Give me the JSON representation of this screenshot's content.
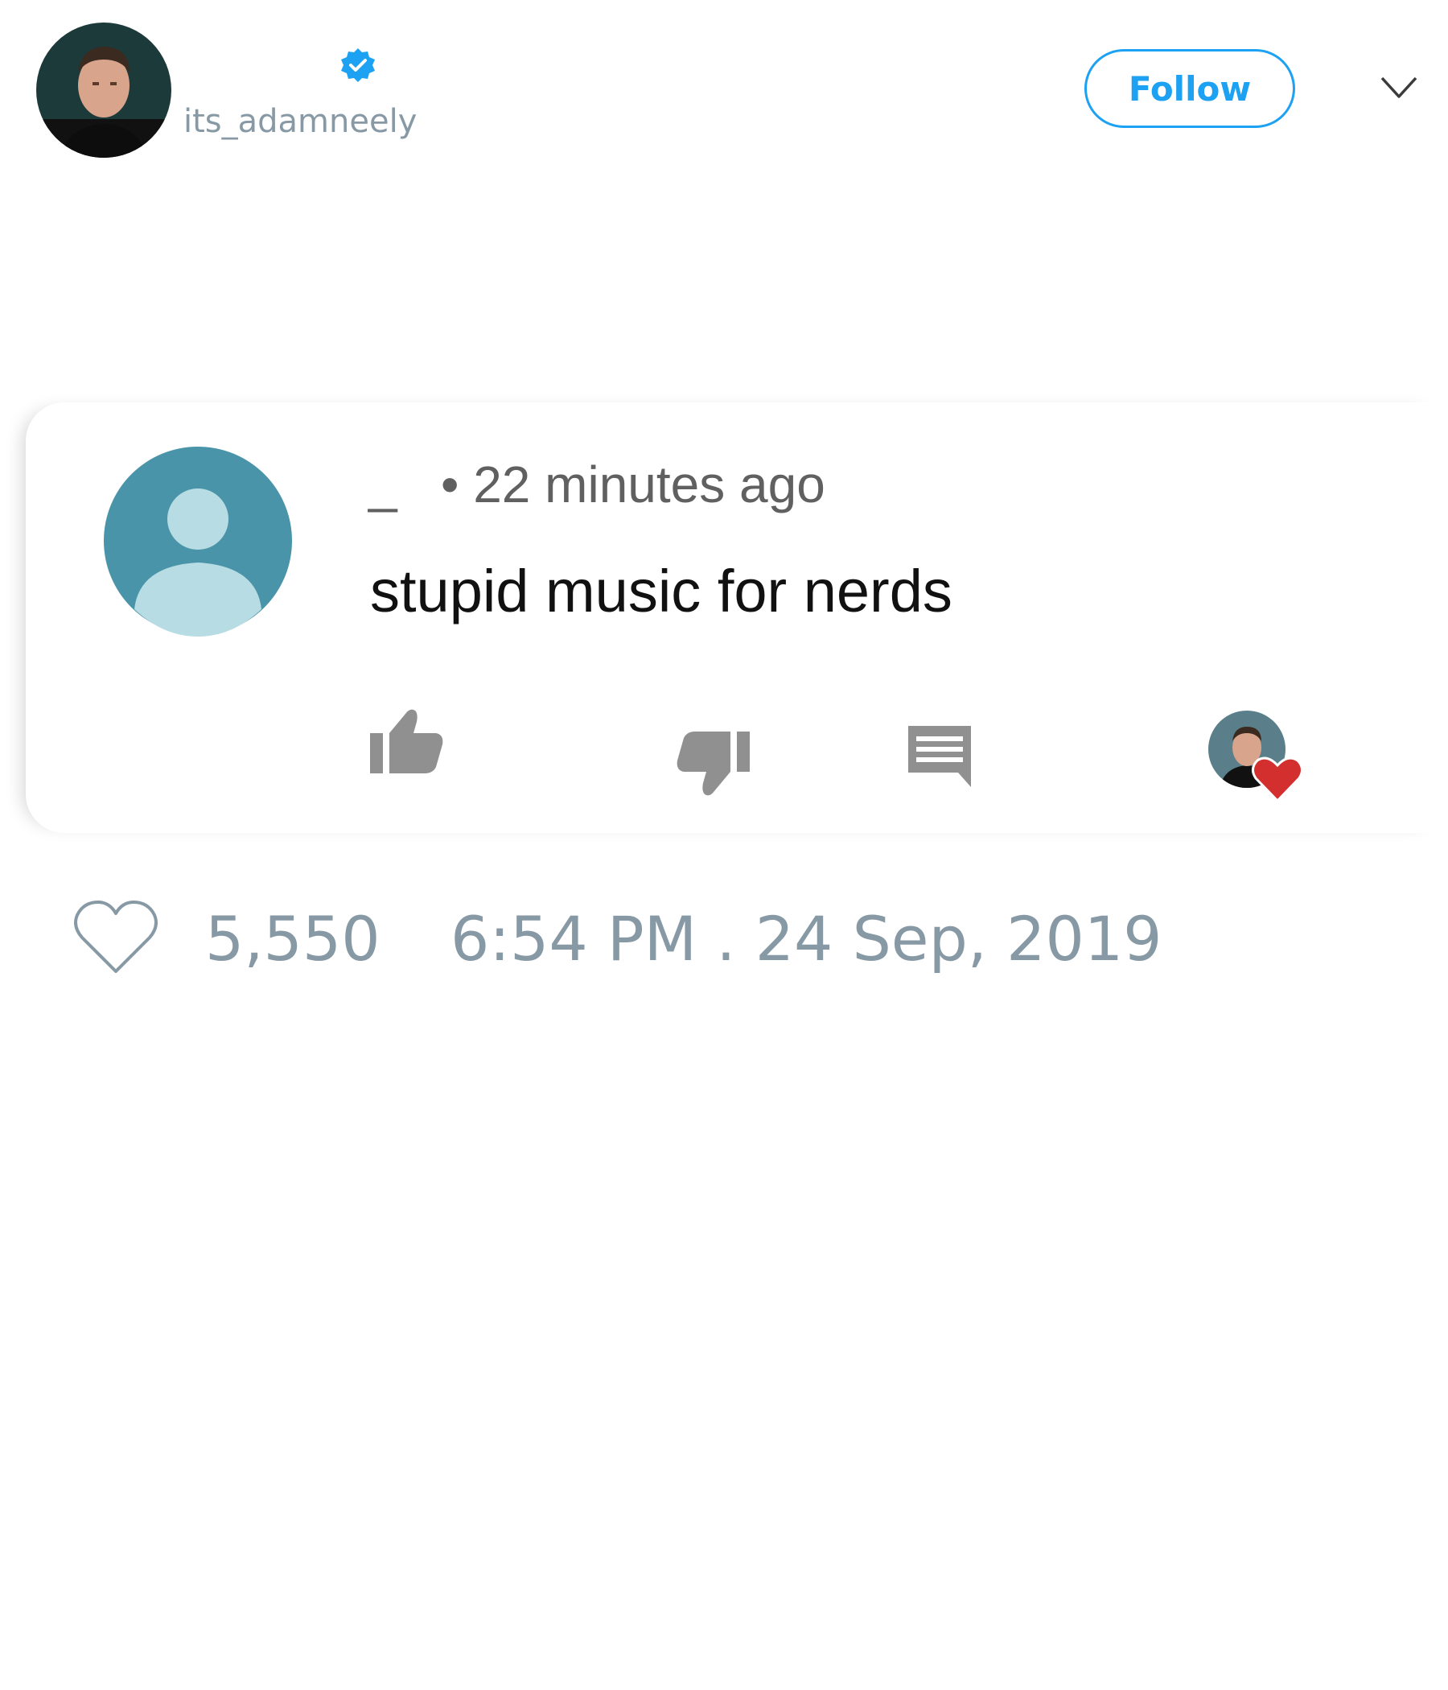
{
  "tweet": {
    "handle": "its_adamneely",
    "follow_label": "Follow",
    "colors": {
      "accent": "#1da1f2",
      "muted": "#8899a6"
    }
  },
  "embedded_comment": {
    "username": "_",
    "time_ago": "• 22 minutes ago",
    "text": "stupid music for nerds",
    "icons": [
      "thumb-up-icon",
      "thumb-down-icon",
      "reply-icon",
      "creator-heart-icon"
    ],
    "colors": {
      "icon_gray": "#909090",
      "heart_red": "#d32f2f",
      "avatar_bg": "#4a94a9",
      "avatar_fg": "#b7dce3"
    }
  },
  "footer": {
    "like_count": "5,550",
    "timestamp": "6:54 PM . 24 Sep, 2019"
  }
}
